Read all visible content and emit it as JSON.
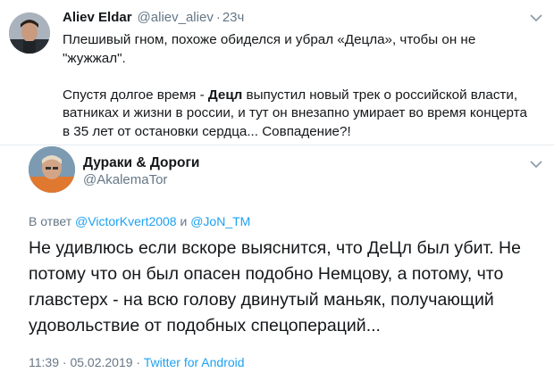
{
  "tweet1": {
    "display_name": "Aliev Eldar",
    "handle": "@aliev_aliev",
    "separator": "·",
    "time": "23ч",
    "text_line1": "Плешивый гном, похоже обиделся и убрал «Децла», чтобы он не \"жужжал\".",
    "text_p2_before": "Спустя долгое время - ",
    "text_p2_bold": "Децл",
    "text_p2_after": " выпустил новый трек о российской власти, ватниках и жизни в россии, и тут он внезапно умирает во время концерта в 35 лет от остановки сердца... Совпадение?!"
  },
  "tweet2": {
    "display_name": "Дураки & Дороги",
    "handle": "@AkalemaTor",
    "reply_prefix": "В ответ",
    "reply_user1": "@VictorKvert2008",
    "reply_joiner": "и",
    "reply_user2": "@JoN_TM",
    "text": "Не удивлюсь если вскоре выяснится, что ДеЦл был убит. Не потому что он был опасен подобно Немцову, а потому, что главстерх - на всю голову двинутый маньяк, получающий удовольствие от подобных спецопераций...",
    "time": "11:39",
    "separator": "·",
    "date": "05.02.2019",
    "source": "Twitter for Android"
  },
  "colors": {
    "text": "#14171a",
    "secondary": "#657786",
    "link": "#1da1f2",
    "divider": "#e6ecf0"
  },
  "icons": [
    "avatar-photo",
    "chevron-down-icon",
    "chevron-down-icon"
  ]
}
